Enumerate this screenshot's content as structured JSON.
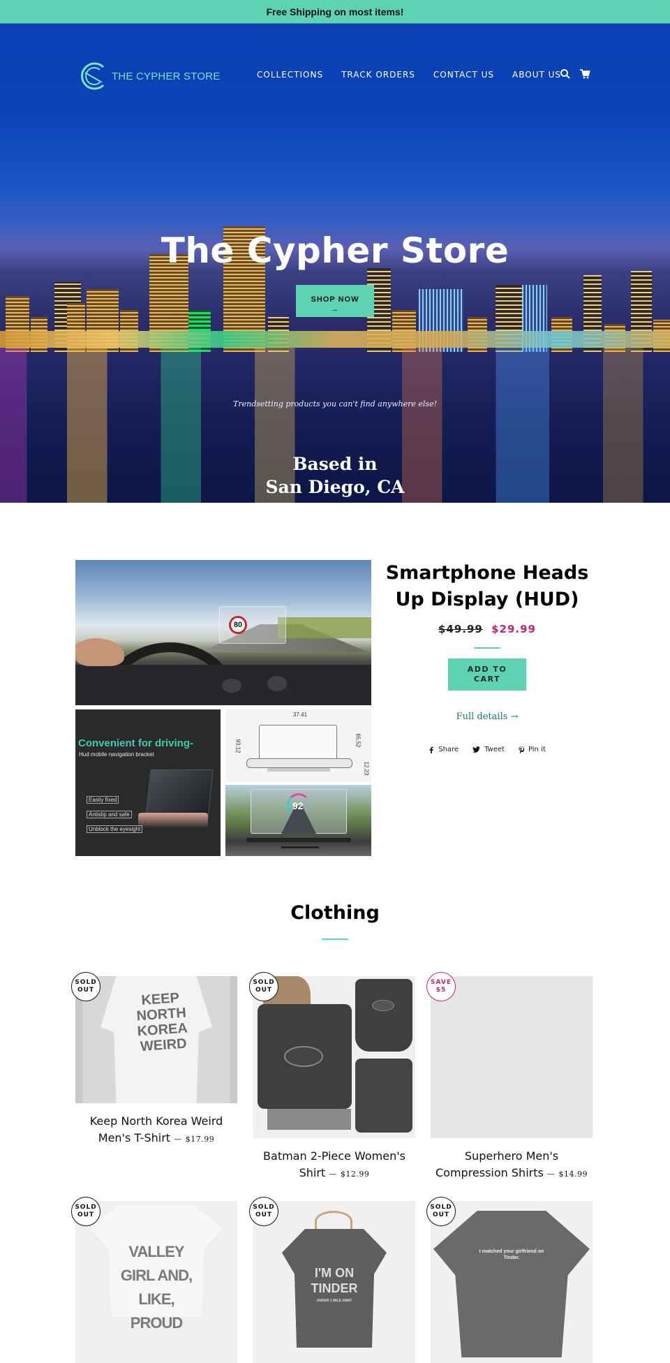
{
  "announcement": "Free Shipping on most items!",
  "header": {
    "logo_text": "THE CYPHER STORE",
    "nav": [
      "COLLECTIONS",
      "TRACK ORDERS",
      "CONTACT US",
      "ABOUT US"
    ],
    "icons": [
      "search-icon",
      "cart-icon"
    ]
  },
  "hero": {
    "title": "The Cypher Store",
    "button_label": "SHOP NOW",
    "button_arrow": "→",
    "tagline": "Trendsetting products you can't find anywhere else!",
    "based_line1": "Based in",
    "based_line2": "San Diego, CA"
  },
  "featured": {
    "title": "Smartphone Heads Up Display (HUD)",
    "price_original": "$49.99",
    "price_sale": "$29.99",
    "add_to_cart": "ADD TO CART",
    "full_details": "Full details →",
    "share": [
      {
        "label": "Share",
        "icon": "facebook-icon"
      },
      {
        "label": "Tweet",
        "icon": "twitter-icon"
      },
      {
        "label": "Pin it",
        "icon": "pinterest-icon"
      }
    ],
    "images": {
      "main_speed": "80",
      "sub1_heading": "Convenient for driving-",
      "sub1_subheading": "Hud mobile navigation bracket",
      "sub1_features": [
        "Easily fixed",
        "Antislip and safe",
        "Unblock the eyesight"
      ],
      "sub2_dims": [
        "37.41",
        "93.12",
        "65.52",
        "12.23"
      ],
      "sub3_speed": "92"
    }
  },
  "collection": {
    "title": "Clothing",
    "separator": "—",
    "products": [
      {
        "name": "Keep North Korea Weird Men's T-Shirt",
        "price": "$17.99",
        "badge": "SOLD OUT",
        "badge_type": "sold",
        "shirt_text": "KEEP NORTH KOREA WEIRD"
      },
      {
        "name": "Batman 2-Piece Women's Shirt",
        "price": "$12.99",
        "badge": "SOLD OUT",
        "badge_type": "sold",
        "shirt_text": ""
      },
      {
        "name": "Superhero Men's Compression Shirts",
        "price": "$14.99",
        "badge": "SAVE $5",
        "badge_type": "save",
        "shirt_text": ""
      },
      {
        "name": "",
        "price": "",
        "badge": "SOLD OUT",
        "badge_type": "sold",
        "shirt_text": "VALLEY GIRL AND, LIKE, PROUD"
      },
      {
        "name": "",
        "price": "",
        "badge": "SOLD OUT",
        "badge_type": "sold",
        "shirt_text": "I'M ON TINDER",
        "shirt_subtext": "UNDER 1 MILE AWAY"
      },
      {
        "name": "",
        "price": "",
        "badge": "SOLD OUT",
        "badge_type": "sold",
        "shirt_text": "I matched your girlfriend on Tinder."
      }
    ]
  },
  "colors": {
    "accent": "#5ed3b3",
    "sale": "#c0237a",
    "link": "#127a6c"
  }
}
